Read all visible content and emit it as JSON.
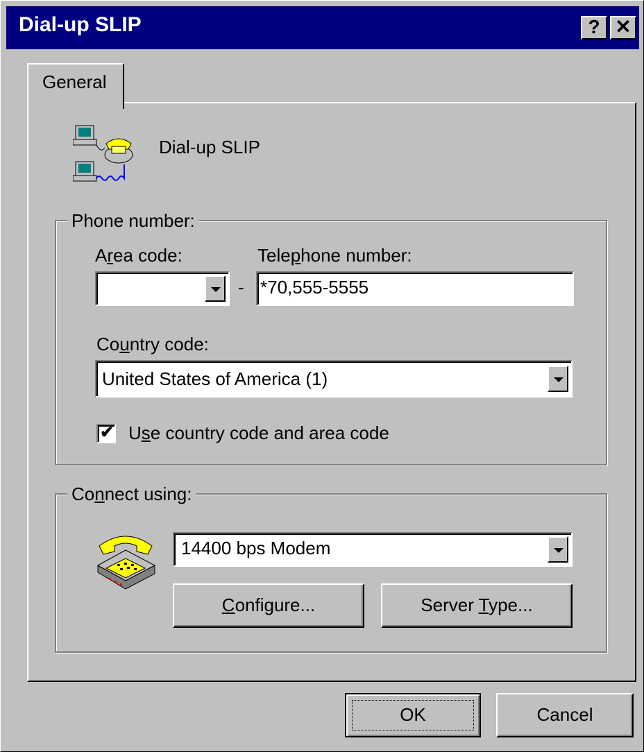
{
  "window": {
    "title": "Dial-up SLIP",
    "help_glyph": "?",
    "close_glyph": "✕"
  },
  "tabs": [
    {
      "label": "General",
      "selected": true
    }
  ],
  "connection": {
    "icon": "dialup-connection-icon",
    "name": "Dial-up SLIP"
  },
  "phone_group": {
    "legend": "Phone number:",
    "area_code_label": "Area code:",
    "area_code_value": "",
    "separator": "-",
    "telephone_label": "Telephone number:",
    "telephone_value": "*70,555-5555",
    "country_label": "Country code:",
    "country_value": "United States of America (1)",
    "use_codes_label": "Use country code and area code",
    "use_codes_checked": true
  },
  "connect_group": {
    "legend": "Connect using:",
    "modem_icon": "telephone-icon",
    "modem_value": "14400 bps Modem",
    "configure_label": "Configure...",
    "server_type_label": "Server Type..."
  },
  "footer": {
    "ok_label": "OK",
    "cancel_label": "Cancel"
  },
  "colors": {
    "titlebar": "#000080",
    "face": "#c0c0c0"
  }
}
